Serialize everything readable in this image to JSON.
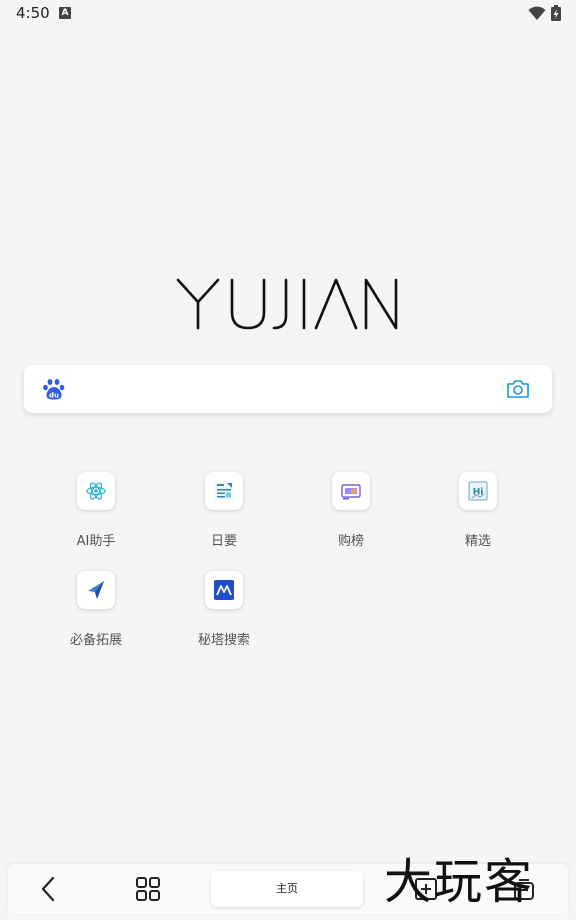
{
  "status_bar": {
    "time": "4:50",
    "notification_icon": "a-letter-icon"
  },
  "logo": {
    "text": "YUJIAN"
  },
  "search": {
    "engine_icon": "baidu-paw-icon",
    "camera_icon": "camera-icon"
  },
  "shortcuts": [
    {
      "label": "AI助手",
      "icon": "ai-atom-icon"
    },
    {
      "label": "日要",
      "icon": "news-document-icon"
    },
    {
      "label": "购榜",
      "icon": "shopping-rank-icon"
    },
    {
      "label": "精选",
      "icon": "hi-picks-icon"
    },
    {
      "label": "必备拓展",
      "icon": "extension-arrow-icon"
    },
    {
      "label": "秘塔搜索",
      "icon": "metaso-mountain-icon"
    }
  ],
  "bottom_bar": {
    "home_label": "主页"
  },
  "watermark": {
    "text": "大玩客"
  },
  "colors": {
    "accent": "#1b9ad8",
    "background": "#f5f5f5",
    "baidu_blue": "#2f5fe0"
  }
}
